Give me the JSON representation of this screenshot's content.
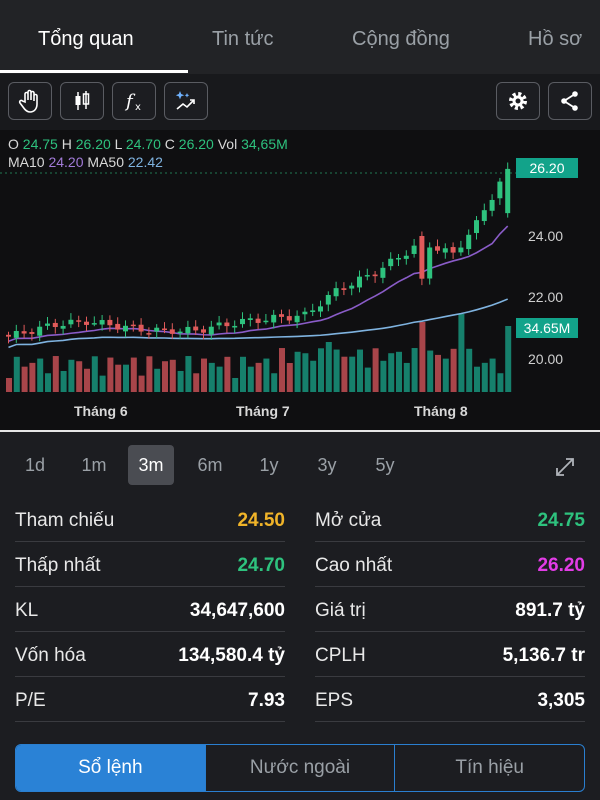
{
  "tabs": [
    {
      "label": "Tổng quan",
      "active": true
    },
    {
      "label": "Tin tức",
      "active": false
    },
    {
      "label": "Cộng đồng",
      "active": false
    },
    {
      "label": "Hồ sơ",
      "active": false
    }
  ],
  "toolbar": {
    "icons": [
      "hand-icon",
      "candlestick-icon",
      "function-icon",
      "ai-chart-icon",
      "settings-icon",
      "share-icon"
    ]
  },
  "ohlc": {
    "o_label": "O",
    "o": "24.75",
    "h_label": "H",
    "h": "26.20",
    "l_label": "L",
    "l": "24.70",
    "c_label": "C",
    "c": "26.20",
    "vol_label": "Vol",
    "vol": "34,65M",
    "ma10_label": "MA10",
    "ma10": "24.20",
    "ma50_label": "MA50",
    "ma50": "22.42"
  },
  "chart": {
    "current_price_tag": "26.20",
    "volume_tag": "34.65M",
    "price_ticks": [
      "24.00",
      "22.00",
      "20.00"
    ],
    "months": [
      "Tháng 6",
      "Tháng 7",
      "Tháng 8"
    ],
    "colors": {
      "up": "#2ec27e",
      "down": "#e05a5a",
      "vol_up": "#16806c",
      "vol_down": "#a8454a",
      "ma10": "#8a5cc8",
      "ma50": "#7fb3e0",
      "accent": "#12a38a"
    }
  },
  "timeframes": [
    "1d",
    "1m",
    "3m",
    "6m",
    "1y",
    "3y",
    "5y"
  ],
  "timeframe_active": "3m",
  "stats": {
    "tham_chieu": {
      "label": "Tham chiếu",
      "value": "24.50",
      "color": "#f0b429"
    },
    "mo_cua": {
      "label": "Mở cửa",
      "value": "24.75",
      "color": "#2ec27e"
    },
    "thap_nhat": {
      "label": "Thấp nhất",
      "value": "24.70",
      "color": "#2ec27e"
    },
    "cao_nhat": {
      "label": "Cao nhất",
      "value": "26.20",
      "color": "#e23ce6"
    },
    "kl": {
      "label": "KL",
      "value": "34,647,600"
    },
    "gia_tri": {
      "label": "Giá trị",
      "value": "891.7 tỷ"
    },
    "von_hoa": {
      "label": "Vốn hóa",
      "value": "134,580.4 tỷ"
    },
    "cplh": {
      "label": "CPLH",
      "value": "5,136.7 tr"
    },
    "pe": {
      "label": "P/E",
      "value": "7.93"
    },
    "eps": {
      "label": "EPS",
      "value": "3,305"
    }
  },
  "bottom_tabs": [
    {
      "label": "Sổ lệnh",
      "active": true
    },
    {
      "label": "Nước ngoài",
      "active": false
    },
    {
      "label": "Tín hiệu",
      "active": false
    }
  ]
}
